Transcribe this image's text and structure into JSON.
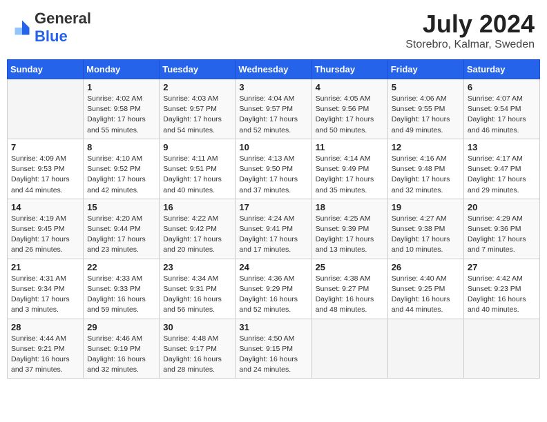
{
  "header": {
    "logo_general": "General",
    "logo_blue": "Blue",
    "title": "July 2024",
    "subtitle": "Storebro, Kalmar, Sweden"
  },
  "calendar": {
    "days_of_week": [
      "Sunday",
      "Monday",
      "Tuesday",
      "Wednesday",
      "Thursday",
      "Friday",
      "Saturday"
    ],
    "weeks": [
      [
        {
          "day": "",
          "info": ""
        },
        {
          "day": "1",
          "info": "Sunrise: 4:02 AM\nSunset: 9:58 PM\nDaylight: 17 hours\nand 55 minutes."
        },
        {
          "day": "2",
          "info": "Sunrise: 4:03 AM\nSunset: 9:57 PM\nDaylight: 17 hours\nand 54 minutes."
        },
        {
          "day": "3",
          "info": "Sunrise: 4:04 AM\nSunset: 9:57 PM\nDaylight: 17 hours\nand 52 minutes."
        },
        {
          "day": "4",
          "info": "Sunrise: 4:05 AM\nSunset: 9:56 PM\nDaylight: 17 hours\nand 50 minutes."
        },
        {
          "day": "5",
          "info": "Sunrise: 4:06 AM\nSunset: 9:55 PM\nDaylight: 17 hours\nand 49 minutes."
        },
        {
          "day": "6",
          "info": "Sunrise: 4:07 AM\nSunset: 9:54 PM\nDaylight: 17 hours\nand 46 minutes."
        }
      ],
      [
        {
          "day": "7",
          "info": "Sunrise: 4:09 AM\nSunset: 9:53 PM\nDaylight: 17 hours\nand 44 minutes."
        },
        {
          "day": "8",
          "info": "Sunrise: 4:10 AM\nSunset: 9:52 PM\nDaylight: 17 hours\nand 42 minutes."
        },
        {
          "day": "9",
          "info": "Sunrise: 4:11 AM\nSunset: 9:51 PM\nDaylight: 17 hours\nand 40 minutes."
        },
        {
          "day": "10",
          "info": "Sunrise: 4:13 AM\nSunset: 9:50 PM\nDaylight: 17 hours\nand 37 minutes."
        },
        {
          "day": "11",
          "info": "Sunrise: 4:14 AM\nSunset: 9:49 PM\nDaylight: 17 hours\nand 35 minutes."
        },
        {
          "day": "12",
          "info": "Sunrise: 4:16 AM\nSunset: 9:48 PM\nDaylight: 17 hours\nand 32 minutes."
        },
        {
          "day": "13",
          "info": "Sunrise: 4:17 AM\nSunset: 9:47 PM\nDaylight: 17 hours\nand 29 minutes."
        }
      ],
      [
        {
          "day": "14",
          "info": "Sunrise: 4:19 AM\nSunset: 9:45 PM\nDaylight: 17 hours\nand 26 minutes."
        },
        {
          "day": "15",
          "info": "Sunrise: 4:20 AM\nSunset: 9:44 PM\nDaylight: 17 hours\nand 23 minutes."
        },
        {
          "day": "16",
          "info": "Sunrise: 4:22 AM\nSunset: 9:42 PM\nDaylight: 17 hours\nand 20 minutes."
        },
        {
          "day": "17",
          "info": "Sunrise: 4:24 AM\nSunset: 9:41 PM\nDaylight: 17 hours\nand 17 minutes."
        },
        {
          "day": "18",
          "info": "Sunrise: 4:25 AM\nSunset: 9:39 PM\nDaylight: 17 hours\nand 13 minutes."
        },
        {
          "day": "19",
          "info": "Sunrise: 4:27 AM\nSunset: 9:38 PM\nDaylight: 17 hours\nand 10 minutes."
        },
        {
          "day": "20",
          "info": "Sunrise: 4:29 AM\nSunset: 9:36 PM\nDaylight: 17 hours\nand 7 minutes."
        }
      ],
      [
        {
          "day": "21",
          "info": "Sunrise: 4:31 AM\nSunset: 9:34 PM\nDaylight: 17 hours\nand 3 minutes."
        },
        {
          "day": "22",
          "info": "Sunrise: 4:33 AM\nSunset: 9:33 PM\nDaylight: 16 hours\nand 59 minutes."
        },
        {
          "day": "23",
          "info": "Sunrise: 4:34 AM\nSunset: 9:31 PM\nDaylight: 16 hours\nand 56 minutes."
        },
        {
          "day": "24",
          "info": "Sunrise: 4:36 AM\nSunset: 9:29 PM\nDaylight: 16 hours\nand 52 minutes."
        },
        {
          "day": "25",
          "info": "Sunrise: 4:38 AM\nSunset: 9:27 PM\nDaylight: 16 hours\nand 48 minutes."
        },
        {
          "day": "26",
          "info": "Sunrise: 4:40 AM\nSunset: 9:25 PM\nDaylight: 16 hours\nand 44 minutes."
        },
        {
          "day": "27",
          "info": "Sunrise: 4:42 AM\nSunset: 9:23 PM\nDaylight: 16 hours\nand 40 minutes."
        }
      ],
      [
        {
          "day": "28",
          "info": "Sunrise: 4:44 AM\nSunset: 9:21 PM\nDaylight: 16 hours\nand 37 minutes."
        },
        {
          "day": "29",
          "info": "Sunrise: 4:46 AM\nSunset: 9:19 PM\nDaylight: 16 hours\nand 32 minutes."
        },
        {
          "day": "30",
          "info": "Sunrise: 4:48 AM\nSunset: 9:17 PM\nDaylight: 16 hours\nand 28 minutes."
        },
        {
          "day": "31",
          "info": "Sunrise: 4:50 AM\nSunset: 9:15 PM\nDaylight: 16 hours\nand 24 minutes."
        },
        {
          "day": "",
          "info": ""
        },
        {
          "day": "",
          "info": ""
        },
        {
          "day": "",
          "info": ""
        }
      ]
    ]
  }
}
